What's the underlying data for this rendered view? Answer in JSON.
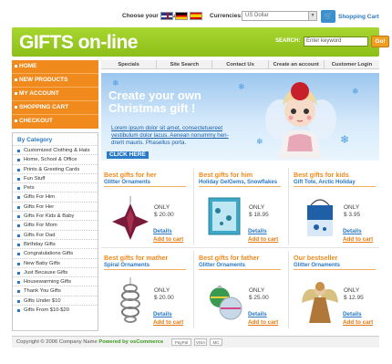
{
  "topbar": {
    "language_label": "Choose your language:",
    "currencies_label": "Currencies:",
    "currency_value": "US Dollar",
    "cart_label": "Shopping Cart"
  },
  "header": {
    "logo": "GIFTS on-line",
    "search_label": "SEARCH:",
    "search_value": "Enter keyword",
    "go_label": "Go!"
  },
  "leftmenu": [
    "HOME",
    "NEW PRODUCTS",
    "MY ACCOUNT",
    "SHOPPING CART",
    "CHECKOUT"
  ],
  "topnav": [
    "Specials",
    "Site Search",
    "Contact Us",
    "Create an account",
    "Customer Login"
  ],
  "banner": {
    "headline_1": "Create your own",
    "headline_2": "Christmas gift !",
    "lorem_1": "Lorem ipsum dolor sit amet, consectetuereet",
    "lorem_2": "vestibulum dolor lacus. Aenean nonummy hen-",
    "lorem_3": "drerit mauris. Phasellus porta.",
    "click_here": "CLICK HERE"
  },
  "categories": {
    "title": "By Category",
    "items": [
      "Customized Clothing & Hats",
      "Home, School & Office",
      "Prints & Greeting Cards",
      "Fun Stuff",
      "Pets",
      "Gifts For Him",
      "Gifts For Her",
      "Gifts For Kids & Baby",
      "Gifts For Mom",
      "Gifts For Dad",
      "Birthday Gifts",
      "Congratulations Gifts",
      "New Baby Gifts",
      "Just Because Gifts",
      "Housewarming Gifts",
      "Thank You Gifts",
      "Gifts Under $10",
      "Gifts From $10-$20"
    ]
  },
  "products": [
    {
      "title": "Best gifts for her",
      "sub": "Glitter Ornaments",
      "only": "ONLY",
      "price": "$ 20.00",
      "details": "Details",
      "add": "Add to cart",
      "icon": "ornament-star-icon"
    },
    {
      "title": "Best gifts for him",
      "sub": "Holiday GelGems, Snowflakes",
      "only": "ONLY",
      "price": "$ 18.95",
      "details": "Details",
      "add": "Add to cart",
      "icon": "gelgems-card-icon"
    },
    {
      "title": "Best gifts for kids",
      "sub": "Gift Tote, Arctic Holiday",
      "only": "ONLY",
      "price": "$ 3.95",
      "details": "Details",
      "add": "Add to cart",
      "icon": "gift-tote-icon"
    },
    {
      "title": "Best gifts for mather",
      "sub": "Spiral Ornaments",
      "only": "ONLY",
      "price": "$ 20.00",
      "details": "Details",
      "add": "Add to cart",
      "icon": "spiral-ornament-icon"
    },
    {
      "title": "Best gifts for father",
      "sub": "Glitter Ornaments",
      "only": "ONLY",
      "price": "$ 25.00",
      "details": "Details",
      "add": "Add to cart",
      "icon": "ball-ornaments-icon"
    },
    {
      "title": "Our bestseller",
      "sub": "Glitter Ornaments",
      "only": "ONLY",
      "price": "$ 12.95",
      "details": "Details",
      "add": "Add to cart",
      "icon": "angel-figurine-icon"
    }
  ],
  "footer": {
    "copyright": "Copyright © 2006 Company Name",
    "powered": "Powered by osCommerce",
    "pay_1": "PayPal",
    "pay_2": "VISA",
    "pay_3": "MC"
  }
}
